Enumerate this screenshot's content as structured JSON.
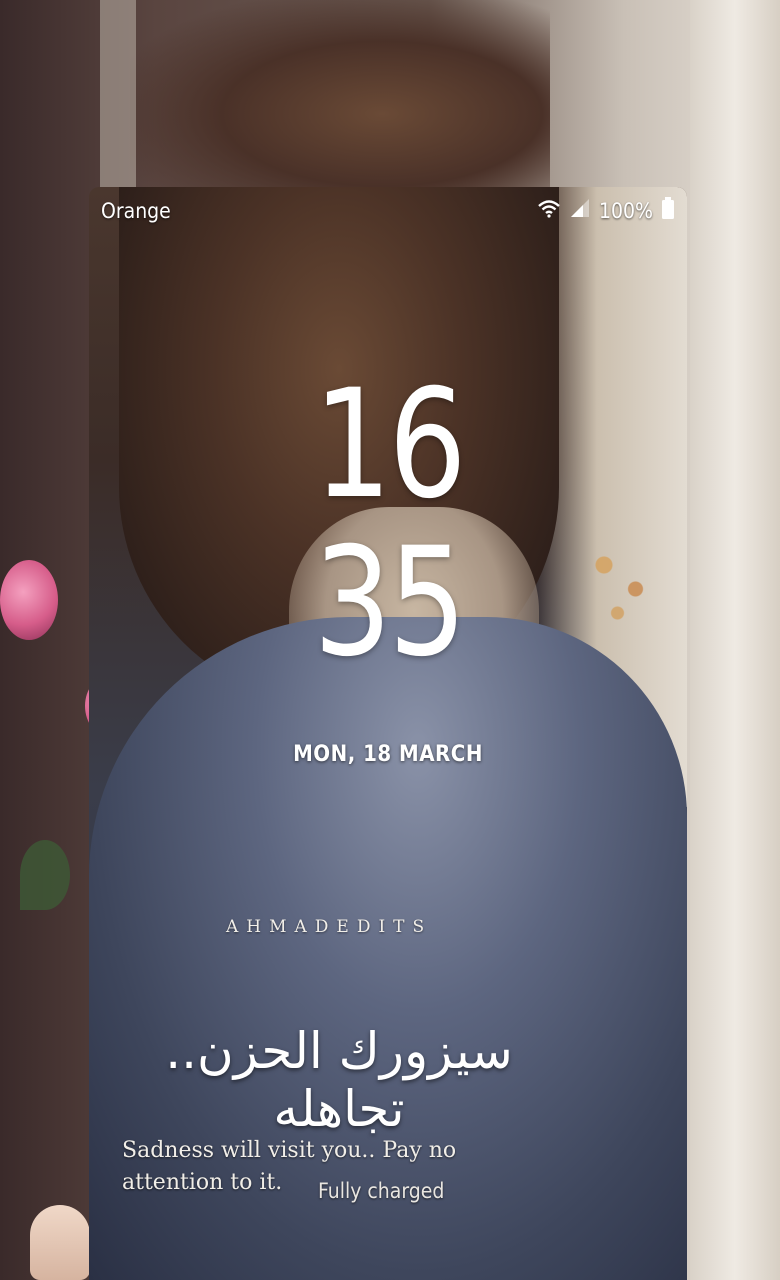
{
  "statusbar": {
    "carrier": "Orange",
    "battery_percent": "100%",
    "battery_level": 1.0,
    "wifi_icon": "wifi-icon",
    "signal_icon": "signal-icon",
    "battery_icon": "battery-icon"
  },
  "clock": {
    "hour": "16",
    "minute": "35"
  },
  "date": "MON, 18 MARCH",
  "quote": {
    "author": "AHMADEDITS",
    "arabic": "سيزورك الحزن.. تجاهله",
    "english": "Sadness will visit you.. Pay no attention to it."
  },
  "charging_status": "Fully charged",
  "colors": {
    "text": "#ffffff"
  }
}
